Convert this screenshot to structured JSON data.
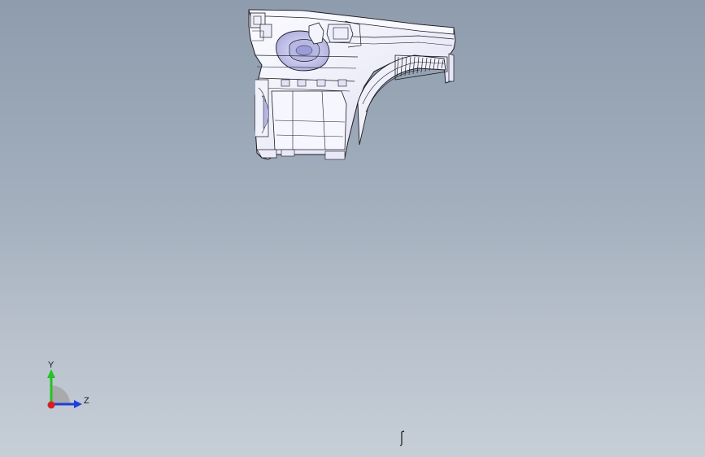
{
  "viewport": {
    "background_top": "#8e9cad",
    "background_bottom": "#c6ced7"
  },
  "model": {
    "fill_light": "#f4f4fb",
    "fill_shade": "#c9c9ea",
    "edge_color": "#1c1c24"
  },
  "triad": {
    "y_label": "Y",
    "z_label": "Z",
    "y_color": "#22c322",
    "z_color": "#1f3fd8",
    "x_color": "#d62020"
  }
}
